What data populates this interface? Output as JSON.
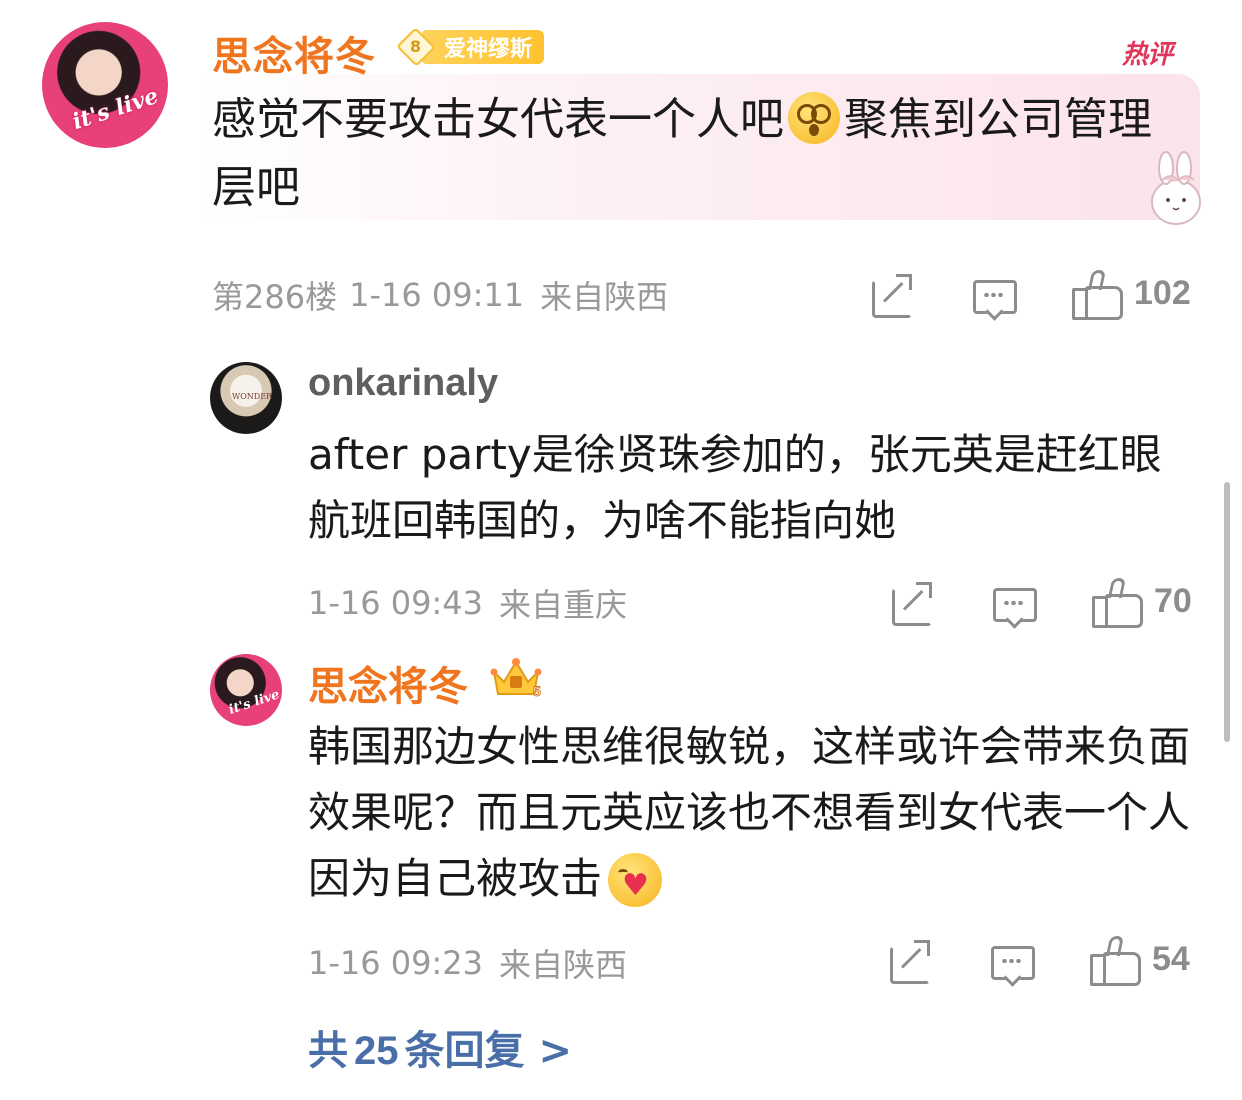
{
  "main_comment": {
    "author": "思念将冬",
    "fan_badge": {
      "level": "8",
      "label": "爱神缪斯"
    },
    "hot_tag": "热评",
    "text_before_emoji": "感觉不要攻击女代表一个人吧",
    "emoji": "dizzy-face",
    "text_after_emoji": "聚焦到公司管理层吧",
    "floor": "第286楼",
    "time": "1-16 09:11",
    "location": "来自陕西",
    "likes": "102",
    "avatar_sticker": "it's live"
  },
  "replies": [
    {
      "author": "onkarinaly",
      "text": "after party是徐贤珠参加的，张元英是赶红眼航班回韩国的，为啥不能指向她",
      "time": "1-16 09:43",
      "location": "来自重庆",
      "likes": "70",
      "avatar_text": "WONDER"
    },
    {
      "author": "思念将冬",
      "author_badge": "crown-level-5",
      "crown_level": "5",
      "text": "韩国那边女性思维很敏锐，这样或许会带来负面效果呢？而且元英应该也不想看到女代表一个人因为自己被攻击",
      "emoji": "hugging-face",
      "time": "1-16 09:23",
      "location": "来自陕西",
      "likes": "54",
      "avatar_sticker": "it's live"
    }
  ],
  "more_replies": {
    "prefix": "共",
    "count": "25",
    "suffix": "条回复",
    "arrow": ">"
  },
  "colors": {
    "author_orange": "#f0751f",
    "meta_gray": "#999999",
    "link_blue": "#4a6fa8",
    "hot_red": "#e0365a",
    "bubble_pink": "#fbe3ea"
  }
}
